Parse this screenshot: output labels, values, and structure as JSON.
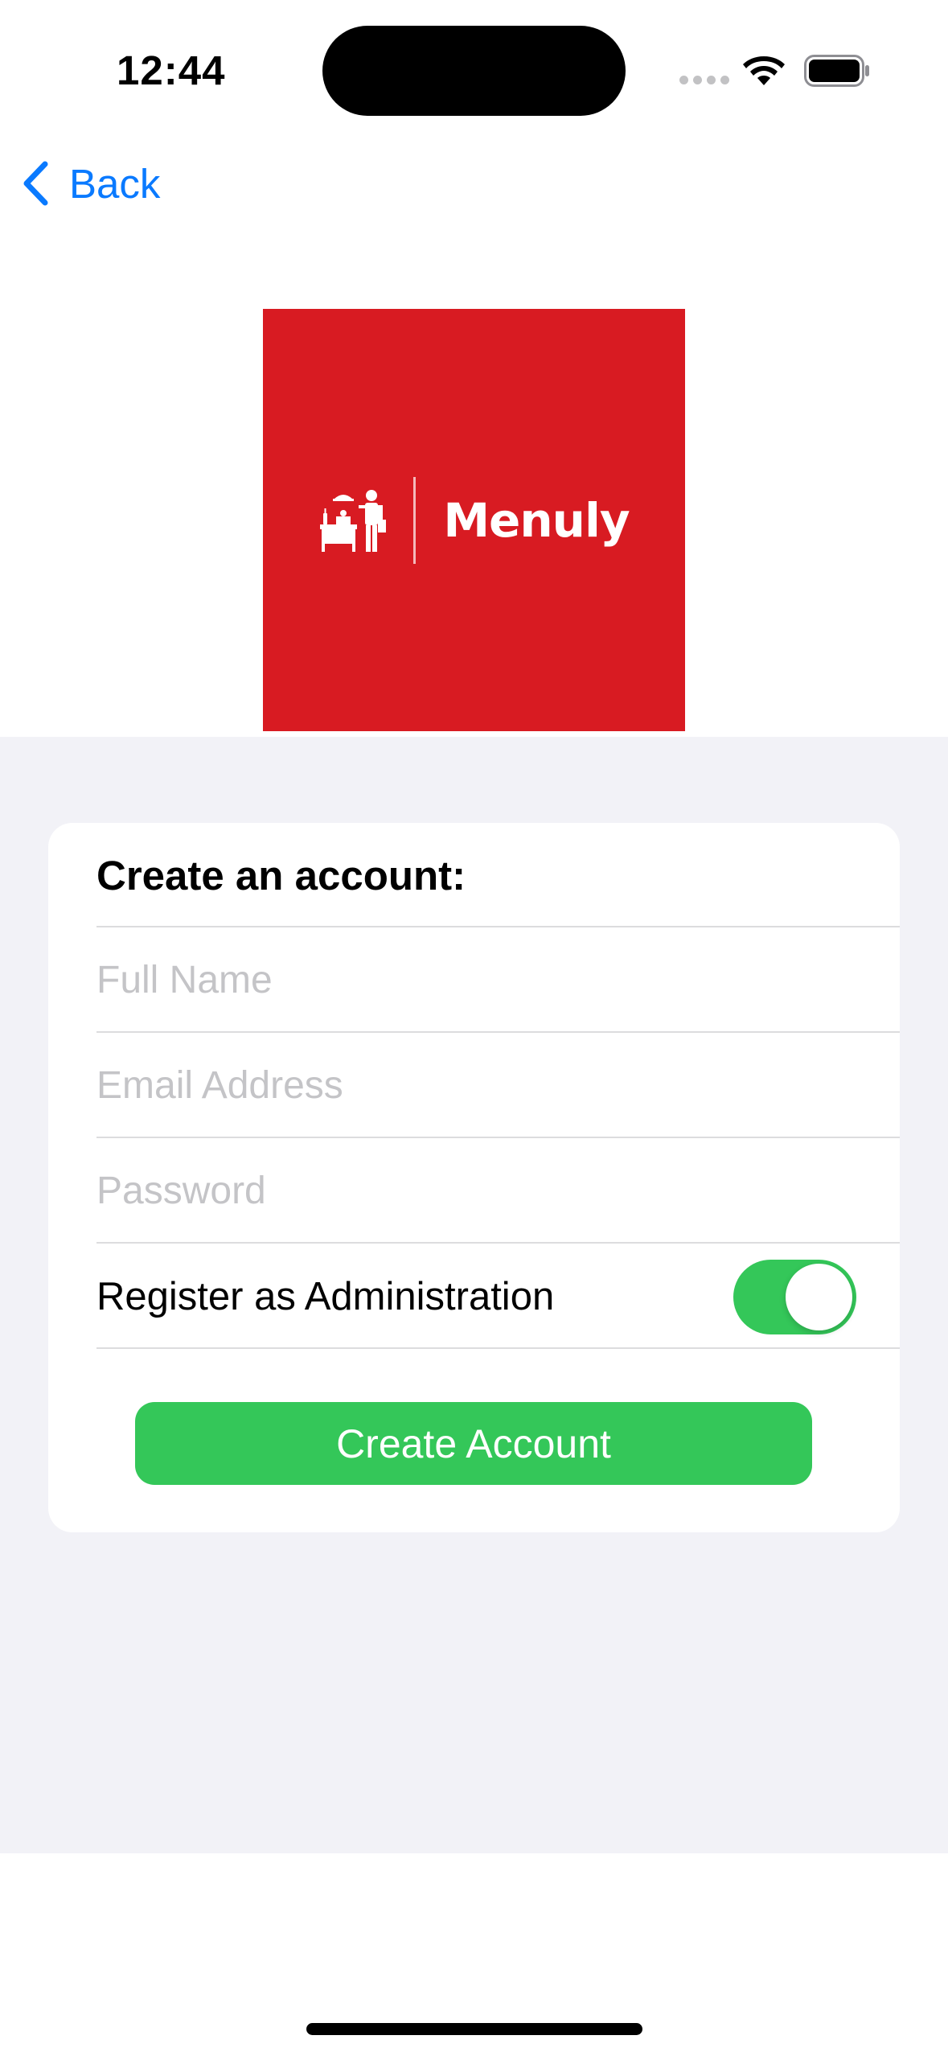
{
  "status_bar": {
    "time": "12:44"
  },
  "nav": {
    "back_label": "Back"
  },
  "logo": {
    "brand_name": "Menuly",
    "background_color": "#d81b22"
  },
  "form": {
    "title": "Create an account:",
    "full_name_placeholder": "Full Name",
    "full_name_value": "",
    "email_placeholder": "Email Address",
    "email_value": "",
    "password_placeholder": "Password",
    "password_value": "",
    "admin_toggle_label": "Register as Administration",
    "admin_toggle_on": true,
    "submit_label": "Create Account"
  },
  "colors": {
    "accent_blue": "#0a7aff",
    "success_green": "#34c759",
    "grouped_background": "#f2f2f7"
  }
}
